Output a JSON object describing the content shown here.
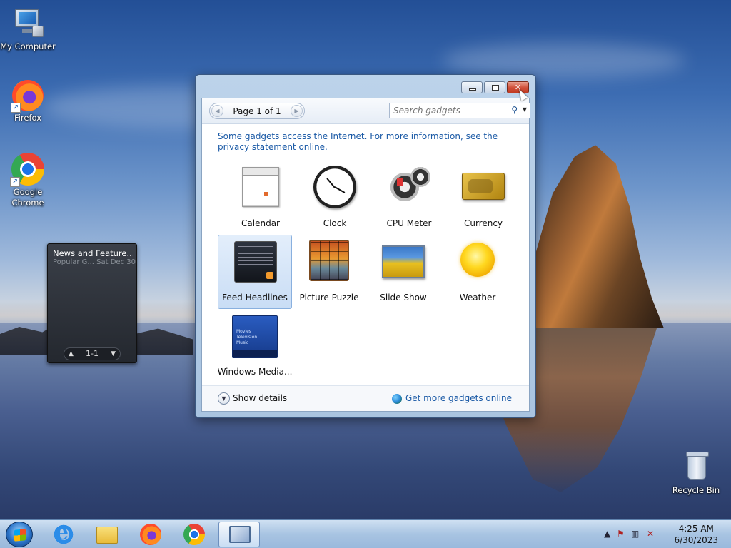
{
  "desktop": {
    "icons": [
      {
        "label": "My Computer",
        "icon": "my-computer-icon"
      },
      {
        "label": "Firefox",
        "icon": "firefox-icon"
      },
      {
        "label": "Google Chrome",
        "icon": "chrome-icon"
      },
      {
        "label": "Recycle Bin",
        "icon": "recycle-bin-icon"
      }
    ]
  },
  "news_gadget": {
    "title": "News and Feature...",
    "subtitle": "Popular G...  Sat Dec 30",
    "nav_label": "1-1"
  },
  "gallery": {
    "page_label": "Page 1 of 1",
    "search_placeholder": "Search gadgets",
    "privacy_text": "Some gadgets access the Internet.  For more information, see the privacy statement online.",
    "gadgets": [
      {
        "label": "Calendar",
        "icon": "calendar-icon"
      },
      {
        "label": "Clock",
        "icon": "clock-icon"
      },
      {
        "label": "CPU Meter",
        "icon": "cpu-meter-icon"
      },
      {
        "label": "Currency",
        "icon": "currency-icon"
      },
      {
        "label": "Feed Headlines",
        "icon": "feed-headlines-icon",
        "selected": true
      },
      {
        "label": "Picture Puzzle",
        "icon": "picture-puzzle-icon"
      },
      {
        "label": "Slide Show",
        "icon": "slide-show-icon"
      },
      {
        "label": "Weather",
        "icon": "weather-icon"
      },
      {
        "label": "Windows Media...",
        "icon": "windows-media-center-icon"
      }
    ],
    "wmc_menu": [
      "Movies",
      "Television",
      "Music"
    ],
    "show_details": "Show details",
    "get_more": "Get more gadgets online"
  },
  "taskbar": {
    "apps": [
      "Internet Explorer",
      "Windows Explorer",
      "Firefox",
      "Google Chrome",
      "Desktop Gadget Gallery"
    ],
    "time": "4:25 AM",
    "date": "6/30/2023"
  },
  "colors": {
    "link": "#1b5aa6",
    "close_button": "#d2533c",
    "selection": "#c9ddf5"
  }
}
